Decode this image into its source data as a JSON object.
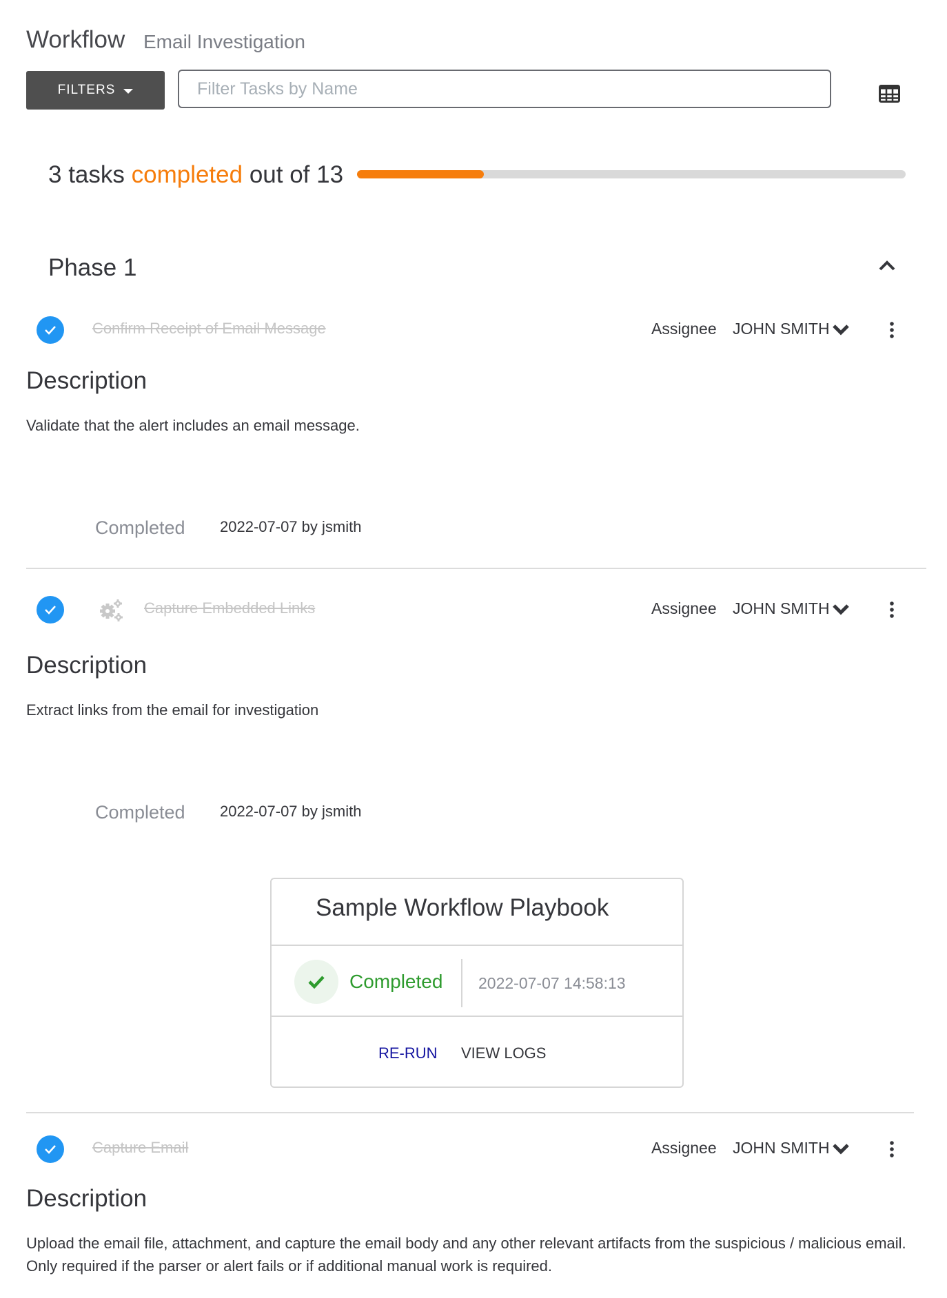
{
  "header": {
    "title": "Workflow",
    "subtitle": "Email Investigation"
  },
  "toolbar": {
    "filters_label": "FILTERS",
    "search_value": "",
    "search_placeholder": "Filter Tasks by Name",
    "view_toggle_icon": "table-grid-icon"
  },
  "progress": {
    "completed_count": "3",
    "prefix": "3 tasks ",
    "accent_word": "completed",
    "suffix": " out of 13",
    "total": 13,
    "completed": 3,
    "fraction": 0.2308,
    "accent_color": "#f67d0c",
    "track_color": "#d9d9d9"
  },
  "phase": {
    "title": "Phase 1",
    "collapse_icon": "chevron-up-icon"
  },
  "tasks": [
    {
      "name": "Confirm Receipt of Email Message",
      "status_icon": "check-circle-icon",
      "type_icon": null,
      "assignee_label": "Assignee",
      "assignee": "JOHN SMITH",
      "description_heading": "Description",
      "description": "Validate that the alert includes an email message.",
      "completed_label": "Completed",
      "completed_value": "2022-07-07 by jsmith"
    },
    {
      "name": "Capture Embedded Links",
      "status_icon": "check-circle-icon",
      "type_icon": "gears-icon",
      "assignee_label": "Assignee",
      "assignee": "JOHN SMITH",
      "description_heading": "Description",
      "description": "Extract links from the email for investigation",
      "completed_label": "Completed",
      "completed_value": "2022-07-07 by jsmith",
      "playbook": {
        "title": "Sample Workflow Playbook",
        "status": "Completed",
        "timestamp": "2022-07-07 14:58:13",
        "rerun_label": "RE-RUN",
        "view_logs_label": "VIEW LOGS",
        "status_color": "#2e9b2e"
      }
    },
    {
      "name": "Capture Email",
      "status_icon": "check-circle-icon",
      "type_icon": null,
      "assignee_label": "Assignee",
      "assignee": "JOHN SMITH",
      "description_heading": "Description",
      "description": "Upload the email file, attachment, and capture the email body and any other relevant artifacts from the suspicious / malicious email. Only required if the parser or alert fails or if additional manual work is required."
    }
  ]
}
